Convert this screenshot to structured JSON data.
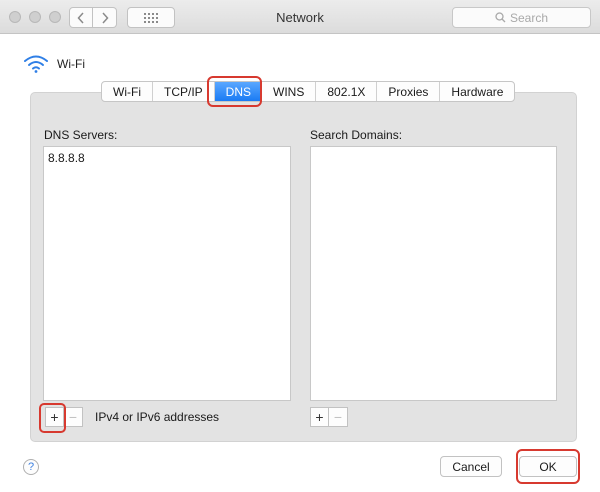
{
  "window": {
    "title": "Network"
  },
  "search": {
    "placeholder": "Search"
  },
  "header": {
    "interface_name": "Wi-Fi"
  },
  "tabs": [
    {
      "label": "Wi-Fi",
      "active": false
    },
    {
      "label": "TCP/IP",
      "active": false
    },
    {
      "label": "DNS",
      "active": true
    },
    {
      "label": "WINS",
      "active": false
    },
    {
      "label": "802.1X",
      "active": false
    },
    {
      "label": "Proxies",
      "active": false
    },
    {
      "label": "Hardware",
      "active": false
    }
  ],
  "dns": {
    "label": "DNS Servers:",
    "servers": [
      "8.8.8.8"
    ],
    "add": "+",
    "remove": "−",
    "hint": "IPv4 or IPv6 addresses"
  },
  "search_domains": {
    "label": "Search Domains:",
    "add": "+",
    "remove": "−"
  },
  "footer": {
    "help": "?",
    "cancel": "Cancel",
    "ok": "OK"
  },
  "colors": {
    "accent": "#1a7bf4",
    "highlight": "#d7392f"
  }
}
